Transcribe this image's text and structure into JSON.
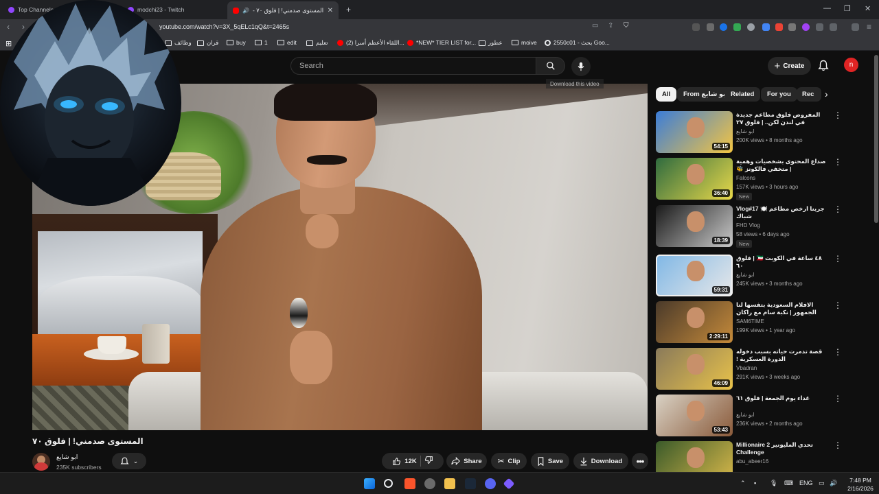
{
  "browser": {
    "tabs": [
      {
        "label": "Top Channels - T",
        "favicon": "twitch-icon",
        "active": false
      },
      {
        "label": "modchi23 - Twitch",
        "favicon": "twitch-icon",
        "active": false
      },
      {
        "label": "المستوى صدمني! | فلوق ٧٠ -",
        "favicon": "youtube-icon",
        "active": true
      }
    ],
    "new_tab_label": "+",
    "url": "youtube.com/watch?v=3X_5qELc1qQ&t=2465s",
    "bookmarks": [
      {
        "label": "وظائف",
        "icon": "folder-icon"
      },
      {
        "label": "قران",
        "icon": "folder-icon"
      },
      {
        "label": "buy",
        "icon": "folder-icon"
      },
      {
        "label": "1",
        "icon": "folder-icon"
      },
      {
        "label": "edit",
        "icon": "folder-icon"
      },
      {
        "label": "تعليم",
        "icon": "folder-icon"
      },
      {
        "label": "(2) اللقاء الأعظم أسرا...",
        "icon": "youtube-icon"
      },
      {
        "label": "*NEW* TIER LIST for...",
        "icon": "youtube-icon"
      },
      {
        "label": "عطور",
        "icon": "folder-icon"
      },
      {
        "label": "moive",
        "icon": "folder-icon"
      },
      {
        "label": "2550c01 - بحث Goo...",
        "icon": "google-icon"
      }
    ]
  },
  "youtube": {
    "search_placeholder": "Search",
    "create_label": "Create",
    "user_initial": "n",
    "download_hint": "Download this video",
    "download_hint_sub": "",
    "video": {
      "title": "المستوى صدمني! | فلوق ٧٠",
      "channel_name": "ابو شايع",
      "subscribers": "235K subscribers",
      "likes": "12K",
      "share_label": "Share",
      "clip_label": "Clip",
      "save_label": "Save",
      "download_label": "Download"
    },
    "chips": [
      "All",
      "From ابو شايع",
      "Related",
      "For you",
      "Rec"
    ],
    "recommendations": [
      {
        "title": "المفروض فلوق مطاعم جديدة في لندن لكن.. | فلوق ٢٧",
        "channel": "ابو شايع",
        "meta": "200K views • 8 months ago",
        "duration": "54:15",
        "badge": "",
        "thumb_colors": [
          "#3b7dd8",
          "#f4c542"
        ],
        "ltr": false
      },
      {
        "title": "صداع المحتوى بشخصيات وهمية | متخفي فالكونز 🐝",
        "channel": "Falcons",
        "meta": "157K views • 3 hours ago",
        "duration": "36:40",
        "badge": "New",
        "thumb_colors": [
          "#2f6b3f",
          "#e8d84a"
        ],
        "ltr": false
      },
      {
        "title": "Vlog#17 🍽️ جربنا ارخص مطاعم شباك",
        "channel": "FHD Vlog",
        "meta": "58 views • 6 days ago",
        "duration": "18:39",
        "badge": "New",
        "thumb_colors": [
          "#1a1a1a",
          "#c9c9c9"
        ],
        "ltr": true
      },
      {
        "title": "٤٨ ساعة في الكويت 🇰🇼 | فلوق ٦٠",
        "channel": "ابو شايع",
        "meta": "245K views • 3 months ago",
        "duration": "59:31",
        "badge": "",
        "thumb_colors": [
          "#7fb7e6",
          "#e8e8e8"
        ],
        "ltr": false
      },
      {
        "title": "الافلام السعودية بتفسها لنا الجمهور | نكبة سام مع راكان الشايع",
        "channel": "SAM6TIME",
        "meta": "199K views • 1 year ago",
        "duration": "2:29:11",
        "badge": "",
        "thumb_colors": [
          "#4a3a2a",
          "#c58a3a"
        ],
        "ltr": false
      },
      {
        "title": "قصة تدمرت حياته بسبب دخوله الدورة العسكرية !",
        "channel": "Vbadran",
        "meta": "291K views • 3 weeks ago",
        "duration": "46:09",
        "badge": "",
        "thumb_colors": [
          "#8a7a5a",
          "#e8c24a"
        ],
        "ltr": false
      },
      {
        "title": "غداء يوم الجمعة | فلوق ٦١",
        "channel": "ابو شايع",
        "meta": "236K views • 2 months ago",
        "duration": "53:43",
        "badge": "",
        "thumb_colors": [
          "#d9d2c5",
          "#8a5a3a"
        ],
        "ltr": false
      },
      {
        "title": "تحدي المليونير 2 Millionaire Challenge",
        "channel": "abu_abeer16",
        "meta": "",
        "duration": "",
        "badge": "",
        "thumb_colors": [
          "#3a5a2a",
          "#d8b84a"
        ],
        "ltr": false
      }
    ]
  },
  "taskbar": {
    "language": "ENG",
    "time": "7:48 PM",
    "date": "2/16/2026"
  },
  "colors": {
    "youtube_red": "#ff0000",
    "background": "#0f0f0f",
    "chip_bg": "#272727"
  }
}
